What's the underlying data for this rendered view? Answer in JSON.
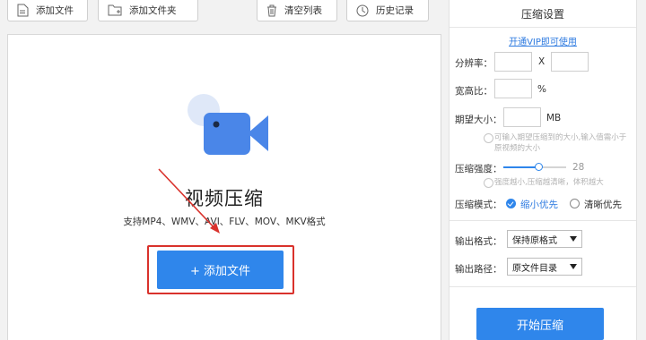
{
  "toolbar": {
    "add_file": "添加文件",
    "add_folder": "添加文件夹",
    "clear_list": "清空列表",
    "history": "历史记录"
  },
  "drop_area": {
    "title": "视频压缩",
    "formats": "支持MP4、WMV、AVI、FLV、MOV、MKV格式",
    "add_button": "+ 添加文件"
  },
  "settings": {
    "title": "压缩设置",
    "vip_link": "开通VIP即可使用",
    "resolution_label": "分辨率：",
    "resolution_sep": "X",
    "aspect_label": "宽高比：",
    "aspect_unit": "%",
    "target_size_label": "期望大小：",
    "target_size_unit": "MB",
    "target_size_hint": "可输入期望压缩到的大小,输入值需小于原视频的大小",
    "strength_label": "压缩强度：",
    "strength_value": "28",
    "strength_fraction": 0.55,
    "strength_hint": "强度越小,压缩越清晰，体积越大",
    "mode_label": "压缩模式：",
    "mode_options": [
      "缩小优先",
      "清晰优先"
    ],
    "mode_selected": 0,
    "output_format_label": "输出格式：",
    "output_format_value": "保持原格式",
    "output_path_label": "输出路径：",
    "output_path_value": "原文件目录",
    "start_button": "开始压缩"
  },
  "colors": {
    "accent": "#2f86eb",
    "highlight_red": "#d9322c",
    "camera_blue": "#4a86e8",
    "camera_halo": "#dfe8f8"
  }
}
